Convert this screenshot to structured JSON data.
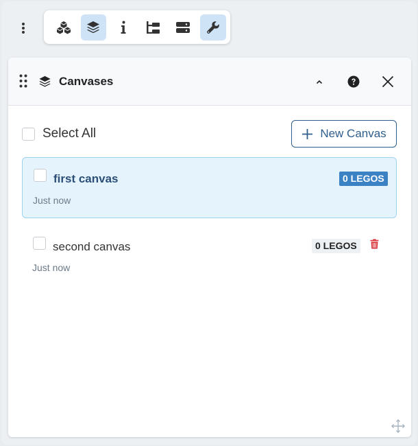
{
  "toolbar": {
    "items": [
      {
        "icon": "cubes-icon",
        "active": false
      },
      {
        "icon": "layers-icon",
        "active": true
      },
      {
        "icon": "info-icon",
        "active": false
      },
      {
        "icon": "hierarchy-icon",
        "active": false
      },
      {
        "icon": "server-icon",
        "active": false
      },
      {
        "icon": "wrench-icon",
        "active": true
      }
    ]
  },
  "panel": {
    "title": "Canvases",
    "select_all_label": "Select All",
    "new_canvas_label": "New Canvas"
  },
  "canvases": [
    {
      "name": "first canvas",
      "time": "Just now",
      "legos": "0 LEGOS",
      "selected": true
    },
    {
      "name": "second canvas",
      "time": "Just now",
      "legos": "0 LEGOS",
      "selected": false
    }
  ],
  "colors": {
    "accent": "#2f5d8c",
    "active_bg": "#cfe3f7",
    "selected_bg": "#e5f4fc",
    "badge_blue": "#3a82c4",
    "delete_red": "#d9363e"
  }
}
